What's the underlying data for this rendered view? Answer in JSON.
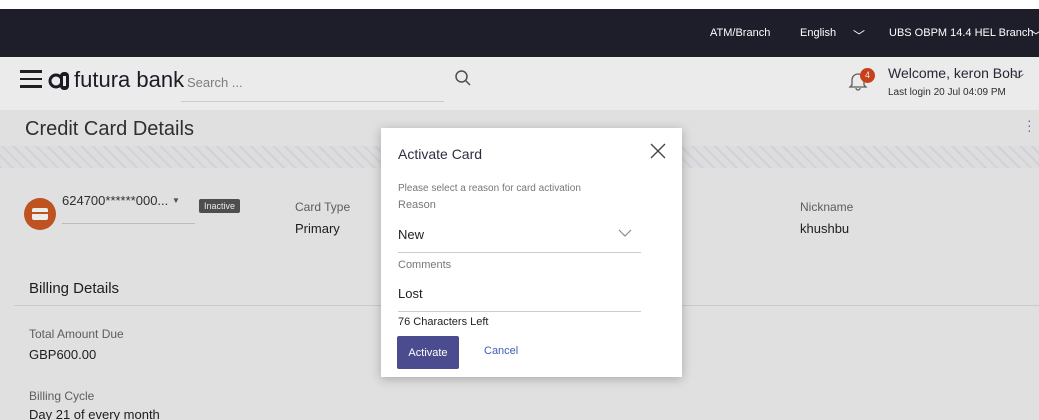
{
  "topbar": {
    "atm_branch": "ATM/Branch",
    "language": "English",
    "branch": "UBS OBPM 14.4 HEL Branch"
  },
  "header": {
    "brand": "futura bank",
    "search_placeholder": "Search ...",
    "notification_count": "4",
    "welcome": "Welcome, keron Bohr",
    "last_login": "Last login 20 Jul 04:09 PM"
  },
  "page": {
    "title": "Credit Card Details",
    "card_number": "624700******000...",
    "card_status": "Inactive",
    "card_type_label": "Card Type",
    "card_type_value": "Primary",
    "nickname_label": "Nickname",
    "nickname_value": "khushbu",
    "billing_title": "Billing Details",
    "total_due_label": "Total Amount Due",
    "total_due_value": "GBP600.00",
    "billing_cycle_label": "Billing Cycle",
    "billing_cycle_value": "Day 21 of every month"
  },
  "modal": {
    "title": "Activate Card",
    "instruction": "Please select a reason for card activation",
    "reason_label": "Reason",
    "reason_value": "New",
    "comments_label": "Comments",
    "comments_value": "Lost",
    "chars_left": "76 Characters Left",
    "activate_label": "Activate",
    "cancel_label": "Cancel"
  },
  "colors": {
    "topbar_bg": "#1e1e2a",
    "accent_button": "#4b4b8f",
    "link": "#3b5db8",
    "card_icon": "#cf5b24",
    "badge": "#d9461e"
  }
}
